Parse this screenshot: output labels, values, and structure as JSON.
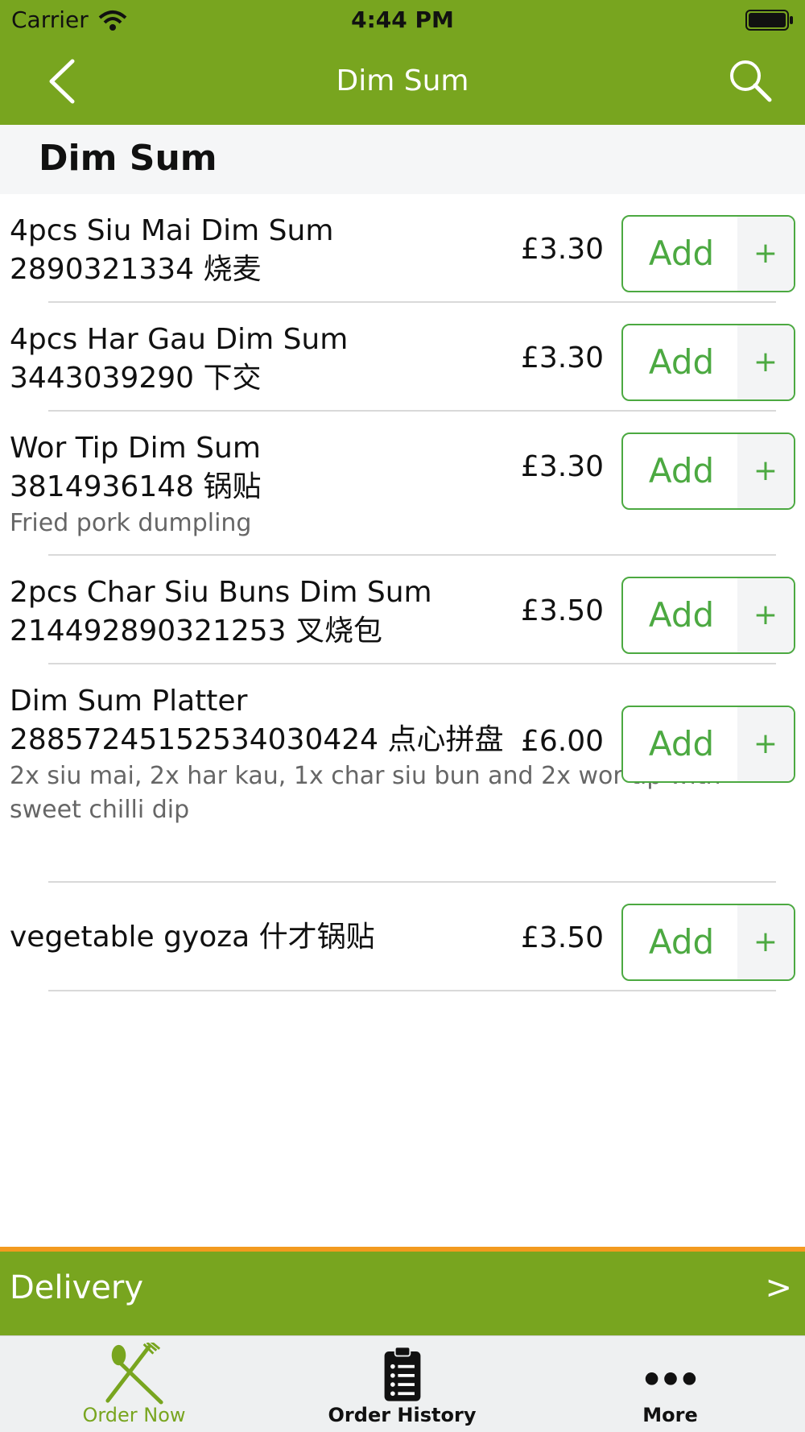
{
  "status": {
    "carrier": "Carrier",
    "time": "4:44 PM"
  },
  "nav": {
    "title": "Dim Sum"
  },
  "section": {
    "title": "Dim Sum"
  },
  "items": [
    {
      "name": "4pcs Siu Mai Dim Sum 2890321334 烧麦",
      "description": "",
      "price": "£3.30"
    },
    {
      "name": "4pcs Har Gau Dim Sum 3443039290 下交",
      "description": "",
      "price": "£3.30"
    },
    {
      "name": "Wor Tip Dim Sum 3814936148 锅贴",
      "description": "Fried pork dumpling",
      "price": "£3.30"
    },
    {
      "name": "2pcs Char Siu Buns Dim Sum 214492890321253 叉烧包",
      "description": "",
      "price": "£3.50"
    },
    {
      "name": "Dim Sum Platter 28857245152534030424 点心拼盘",
      "description": "2x siu mai, 2x har kau, 1x char siu bun and 2x wor tip with sweet chilli dip",
      "price": "£6.00"
    },
    {
      "name": "vegetable gyoza 什才锅贴",
      "description": "",
      "price": "£3.50"
    }
  ],
  "add_button": {
    "label": "Add",
    "plus": "+"
  },
  "delivery": {
    "label": "Delivery",
    "chevron": ">"
  },
  "tabs": [
    {
      "label": "Order Now",
      "icon": "fork-knife-icon",
      "active": true
    },
    {
      "label": "Order History",
      "icon": "clipboard-icon",
      "active": false
    },
    {
      "label": "More",
      "icon": "more-dots-icon",
      "active": false
    }
  ],
  "colors": {
    "brand_green": "#78a51f",
    "button_green": "#4ca941",
    "accent_orange": "#f39a1f"
  }
}
